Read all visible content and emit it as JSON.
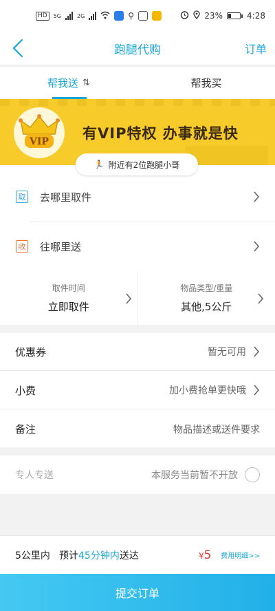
{
  "status_bar": {
    "hd_label": "HD",
    "signal1_label": "5G",
    "signal2_label": "2G",
    "battery_percent": "23%",
    "battery_level": 0.23,
    "time": "4:28"
  },
  "nav": {
    "title": "跑腿代购",
    "order_link": "订单"
  },
  "tabs": [
    {
      "label": "帮我送",
      "active": true
    },
    {
      "label": "帮我买",
      "active": false
    }
  ],
  "banner": {
    "vip_badge": "VIP",
    "slogan": "有VIP特权  办事就是快",
    "runners_nearby": "附近有2位跑腿小哥"
  },
  "address": {
    "pickup_tag": "取",
    "pickup_placeholder": "去哪里取件",
    "delivery_tag": "收",
    "delivery_placeholder": "往哪里送"
  },
  "details": {
    "pickup_time_caption": "取件时间",
    "pickup_time_value": "立即取件",
    "item_type_caption": "物品类型/重量",
    "item_type_value": "其他,5公斤"
  },
  "options": {
    "coupon_label": "优惠券",
    "coupon_value": "暂无可用",
    "tip_label": "小费",
    "tip_value": "加小费抢单更快哦",
    "note_label": "备注",
    "note_placeholder": "物品描述或送件要求"
  },
  "express": {
    "label": "专人专送",
    "value": "本服务当前暂不开放"
  },
  "summary": {
    "distance": "5公里内",
    "eta_prefix": "预计",
    "eta_highlight": "45分钟内",
    "eta_suffix": "送达",
    "price_symbol": "¥",
    "price": "5",
    "fee_detail": "费用明细>>"
  },
  "submit_label": "提交订单",
  "colors": {
    "accent": "#1aa7d6",
    "banner": "#f7cc2a",
    "price": "#e53935",
    "submit_start": "#45c9f2",
    "submit_end": "#21b0e8"
  }
}
